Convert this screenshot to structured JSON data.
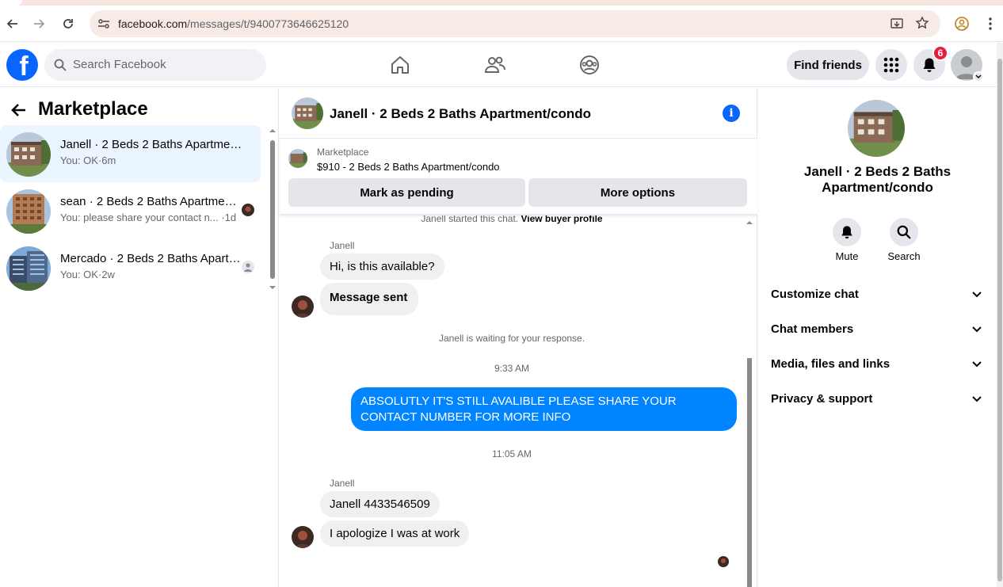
{
  "browser": {
    "url_host": "facebook.com",
    "url_path": "/messages/t/9400773646625120"
  },
  "header": {
    "search_placeholder": "Search Facebook",
    "find_friends_label": "Find friends",
    "notification_count": "6"
  },
  "sidebar": {
    "title": "Marketplace",
    "conversations": [
      {
        "name": "Janell · 2 Beds 2 Baths Apartment/condo",
        "preview": "You: OK·6m",
        "active": true
      },
      {
        "name": "sean · 2 Beds 2 Baths Apartment/condo",
        "preview": "You: please share your contact n... ·1d",
        "active": false
      },
      {
        "name": "Mercado · 2 Beds 2 Baths Apartment/condo",
        "preview": "You: OK·2w",
        "active": false
      }
    ]
  },
  "chat": {
    "title": "Janell · 2 Beds 2 Baths Apartment/condo",
    "listing": {
      "label": "Marketplace",
      "price_title": "$910 - 2 Beds 2 Baths Apartment/condo",
      "mark_pending_label": "Mark as pending",
      "more_options_label": "More options"
    },
    "started_text": "Janell started this chat.",
    "view_profile_text": "View buyer profile",
    "messages": {
      "sender_1": "Janell",
      "msg_1": "Hi, is this available?",
      "msg_2": "Message sent",
      "waiting_text": "Janell is waiting for your response.",
      "time_1": "9:33 AM",
      "my_msg": "ABSOLUTLY IT'S STILL AVALIBLE PLEASE SHARE YOUR CONTACT NUMBER  FOR MORE INFO",
      "time_2": "11:05 AM",
      "sender_2": "Janell",
      "msg_3": "Janell 4433546509",
      "msg_4": "I apologize I was at work"
    }
  },
  "right_panel": {
    "title": "Janell · 2 Beds 2 Baths Apartment/condo",
    "mute_label": "Mute",
    "search_label": "Search",
    "sections": [
      "Customize chat",
      "Chat members",
      "Media, files and links",
      "Privacy & support"
    ]
  },
  "colors": {
    "brand_blue": "#0866ff",
    "my_bubble": "#0084ff",
    "active_conv": "#ebf5ff",
    "notification_red": "#e41e3f"
  }
}
